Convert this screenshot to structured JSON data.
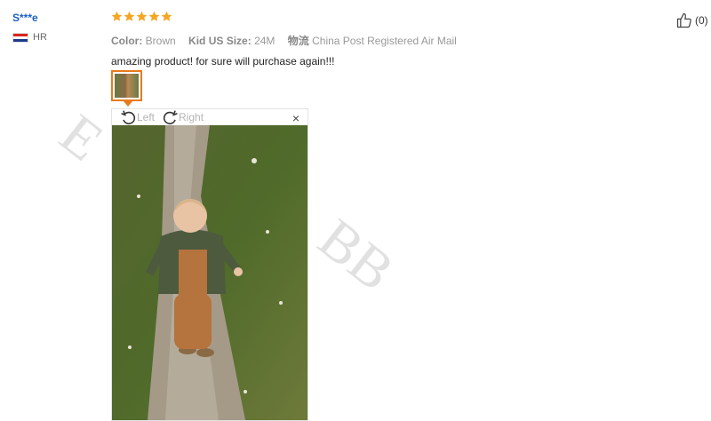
{
  "reviewer": {
    "name": "S***e",
    "country_code": "HR"
  },
  "review": {
    "rating": 5,
    "attributes": [
      {
        "key": "Color:",
        "value": "Brown"
      },
      {
        "key": "Kid US Size:",
        "value": "24M"
      },
      {
        "key": "物流",
        "value": "China Post Registered Air Mail"
      }
    ],
    "text": "amazing product! for sure will purchase again!!!"
  },
  "viewer": {
    "rotate_left": "Left",
    "rotate_right": "Right",
    "close": "×"
  },
  "like": {
    "count": "(0)"
  },
  "watermark": {
    "left": "E",
    "right": "BB"
  },
  "colors": {
    "star": "#f5a623",
    "username": "#1a5ec1",
    "thumb_border": "#e87a1c"
  }
}
